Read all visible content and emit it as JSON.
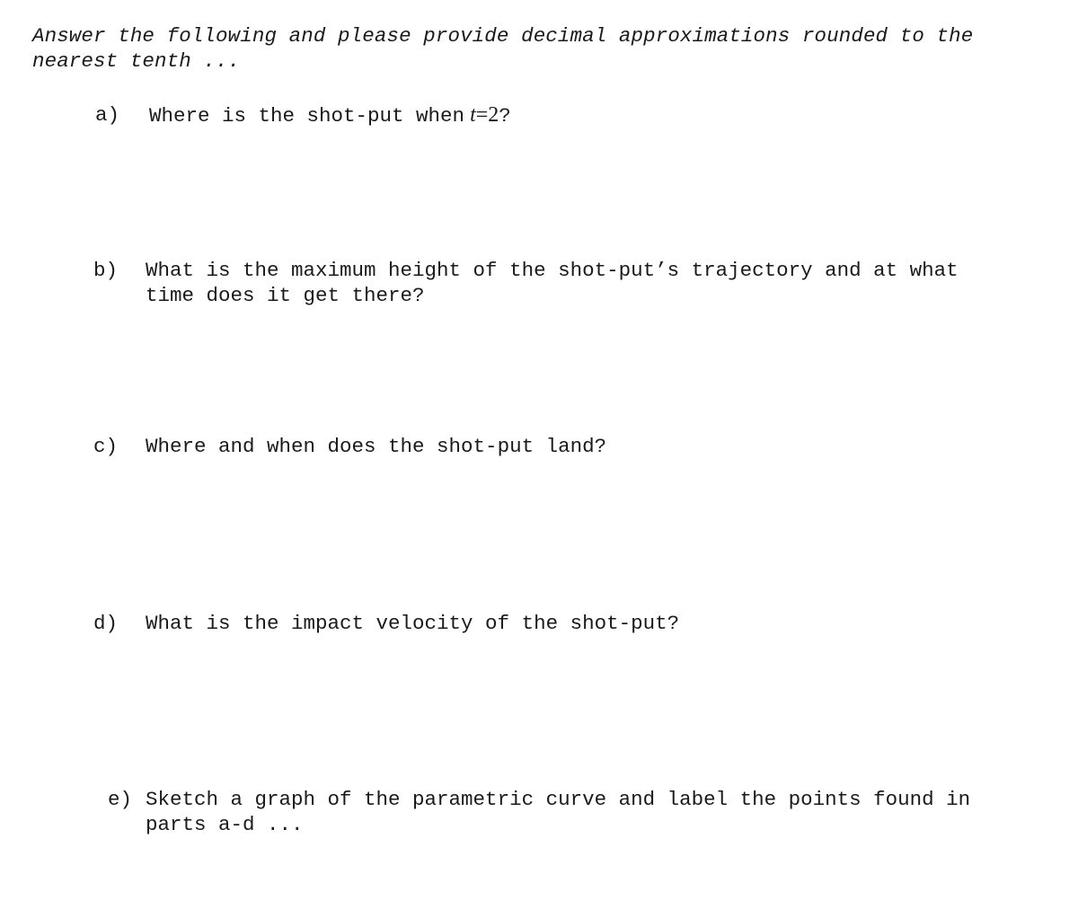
{
  "instructions": "Answer the following and please provide decimal approximations rounded to the nearest tenth ...",
  "questions": [
    {
      "label": "a)",
      "text_before": "Where is the shot-put when",
      "variable": "t",
      "equals": "=",
      "value": "2",
      "text_after": "?"
    },
    {
      "label": "b)",
      "text": "What is the maximum height of the shot-put’s trajectory and at what time does it get there?"
    },
    {
      "label": "c)",
      "text": "Where and when does the shot-put land?"
    },
    {
      "label": "d)",
      "text": "What is the impact velocity of the shot-put?"
    },
    {
      "label": "e)",
      "text": "Sketch a graph of the parametric curve and label the points found in parts a-d ..."
    }
  ]
}
